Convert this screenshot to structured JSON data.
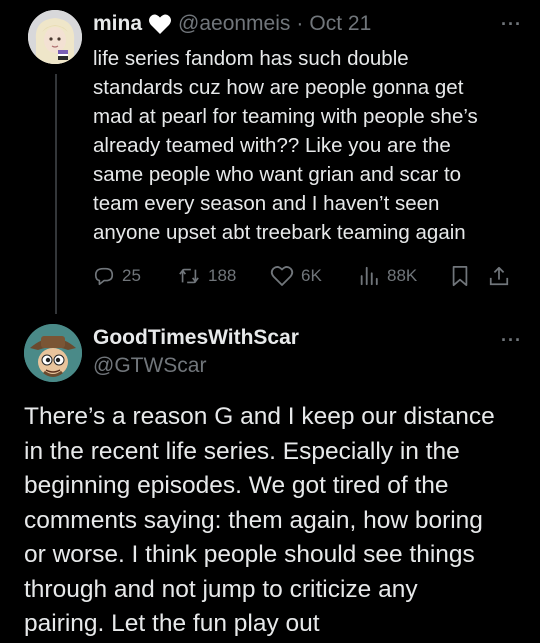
{
  "tweet1": {
    "author_name": "mina",
    "handle": "@aeonmeis",
    "separator": "·",
    "date": "Oct 21",
    "more_label": "···",
    "body_lines": [
      "life series fandom has such double",
      "standards cuz how are people gonna get",
      "mad at pearl for teaming with people she’s",
      "already teamed with?? Like you are the",
      "same people who want grian and scar to",
      "team every season and I haven’t seen",
      "anyone upset abt treebark teaming again"
    ],
    "stats": {
      "replies": "25",
      "reposts": "188",
      "likes": "6K",
      "views": "88K"
    },
    "icons": [
      "white-heart-icon",
      "reply-icon",
      "repost-icon",
      "like-icon",
      "views-icon",
      "bookmark-icon",
      "share-icon"
    ]
  },
  "tweet2": {
    "author_name": "GoodTimesWithScar",
    "handle": "@GTWScar",
    "more_label": "···",
    "body_lines": [
      "There’s a reason G and I keep our distance",
      "in the recent life series. Especially in the",
      "beginning episodes. We got tired of the",
      "comments saying: them again, how boring",
      "or worse. I think people should see things",
      "through and not jump to criticize any",
      "pairing. Let the fun play out"
    ]
  },
  "colors": {
    "background": "#000000",
    "primary_text": "#e7e9ea",
    "secondary_text": "#71767b",
    "thread_line": "#333639"
  }
}
